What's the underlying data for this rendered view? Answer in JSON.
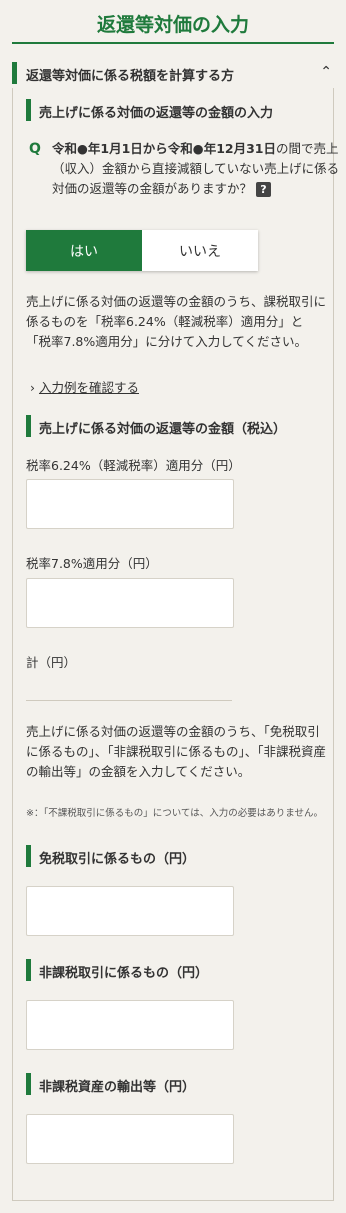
{
  "page_title": "返還等対価の入力",
  "section": {
    "label": "返還等対価に係る税額を計算する方",
    "chevron_icon": "chevron-up-icon"
  },
  "q1": {
    "heading": "売上げに係る対価の返還等の金額の入力",
    "mark": "Q",
    "line1_bold": "令和●年1月1日から令和●年12月31日",
    "line1_rest": "の間で売上（収入）金額から直接減額していない売上げに係る対価の返還等の金額がありますか？",
    "help": "?",
    "yes": "はい",
    "no": "いいえ",
    "selected": "はい"
  },
  "instruction1": "売上げに係る対価の返還等の金額のうち、課税取引に係るものを「税率6.24%（軽減税率）適用分」と「税率7.8%適用分」に分けて入力してください。",
  "example_link": "入力例を確認する",
  "amount": {
    "heading": "売上げに係る対価の返還等の金額（税込）",
    "rate_reduced_label": "税率6.24%（軽減税率）適用分（円）",
    "rate_reduced_value": "",
    "rate_standard_label": "税率7.8%適用分（円）",
    "rate_standard_value": "",
    "total_label": "計（円）",
    "total_value": ""
  },
  "instruction2": "売上げに係る対価の返還等の金額のうち、「免税取引に係るもの」、「非課税取引に係るもの」、「非課税資産の輸出等」の金額を入力してください。",
  "note": "※：「不課税取引に係るもの」については、入力の必要はありません。",
  "exempt": {
    "heading": "免税取引に係るもの（円）",
    "value": ""
  },
  "nontaxable": {
    "heading": "非課税取引に係るもの（円）",
    "value": ""
  },
  "export": {
    "heading": "非課税資産の輸出等（円）",
    "value": ""
  },
  "colors": {
    "accent": "#1f7a3c",
    "background": "#f3f1ec"
  }
}
